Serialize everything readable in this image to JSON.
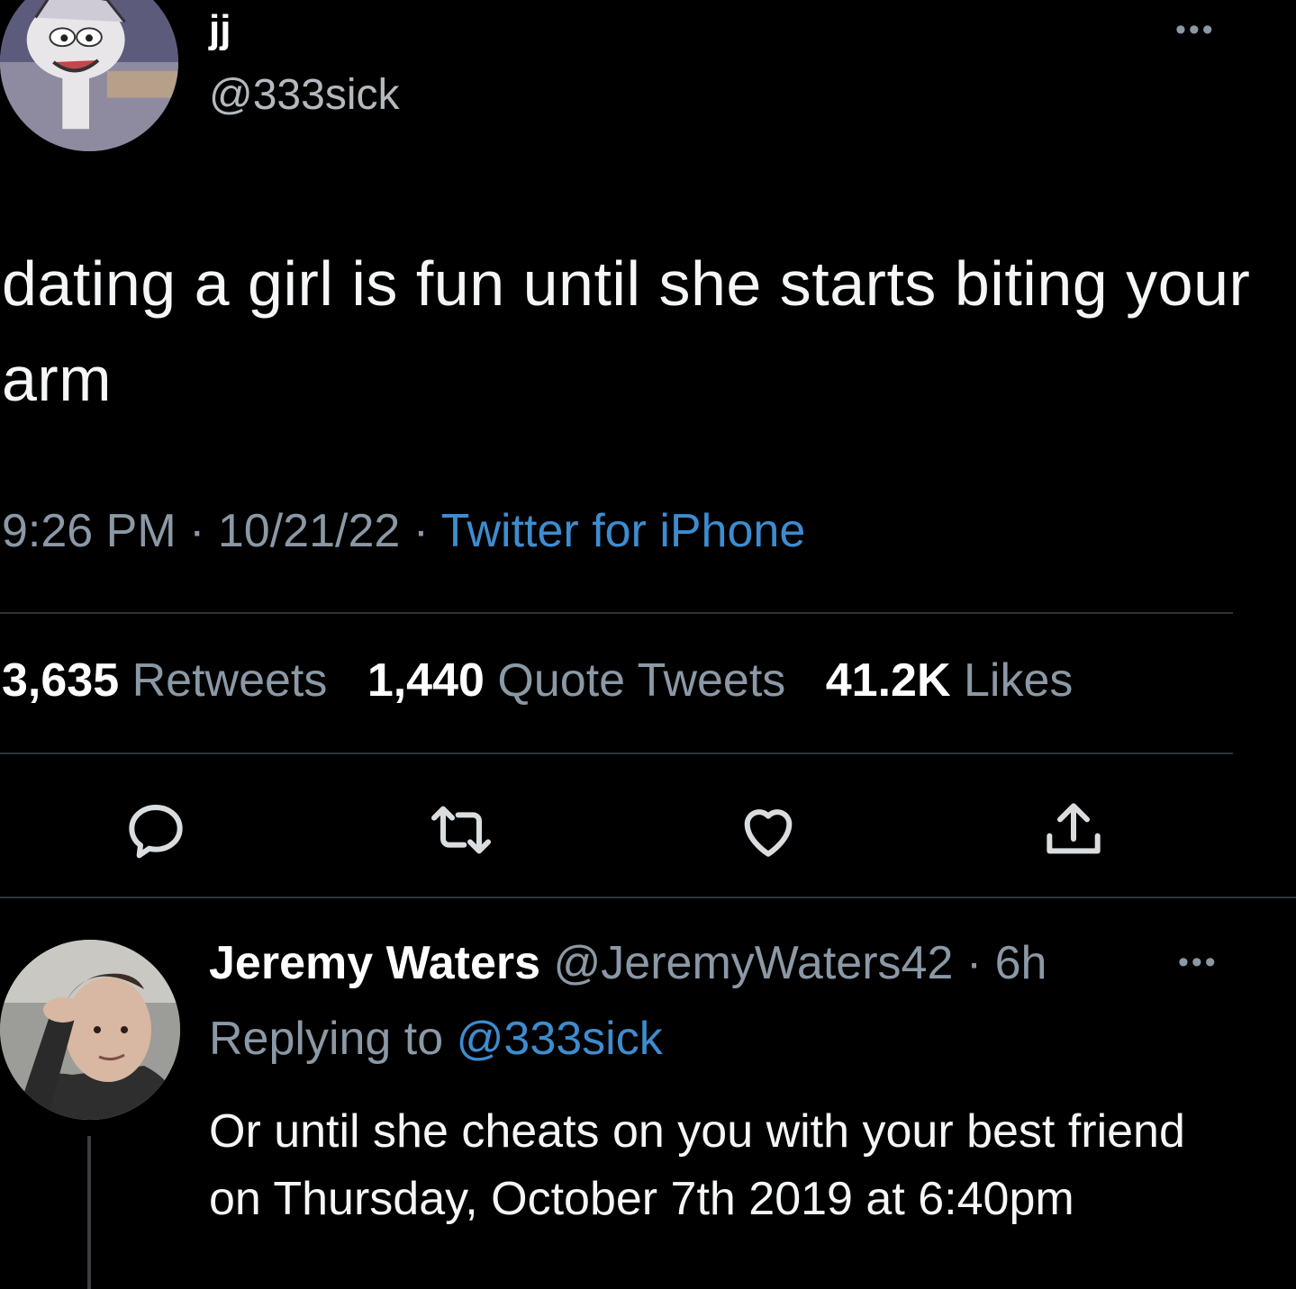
{
  "tweet": {
    "display_name": "jj",
    "handle": "@333sick",
    "more_icon": "more-dots-icon",
    "text": "dating a girl is fun until she starts biting your arm",
    "time": "9:26 PM",
    "date": "10/21/22",
    "separator": "·",
    "source": "Twitter for iPhone"
  },
  "stats": {
    "retweets_count": "3,635",
    "retweets_label": "Retweets",
    "quotes_count": "1,440",
    "quotes_label": "Quote Tweets",
    "likes_count": "41.2K",
    "likes_label": "Likes"
  },
  "actions": {
    "icons": [
      "reply-icon",
      "retweet-icon",
      "like-icon",
      "share-icon"
    ]
  },
  "reply": {
    "display_name": "Jeremy Waters",
    "handle": "@JeremyWaters42",
    "separator": "·",
    "age": "6h",
    "replying_label": "Replying to",
    "replying_to": "@333sick",
    "text": "Or until she cheats on you with your best friend on Thursday, October 7th 2019 at 6:40pm"
  },
  "colors": {
    "background": "#000000",
    "text": "#e7e9ea",
    "muted": "#8b98a5",
    "link": "#3e8ccf",
    "divider": "#2f3336"
  }
}
